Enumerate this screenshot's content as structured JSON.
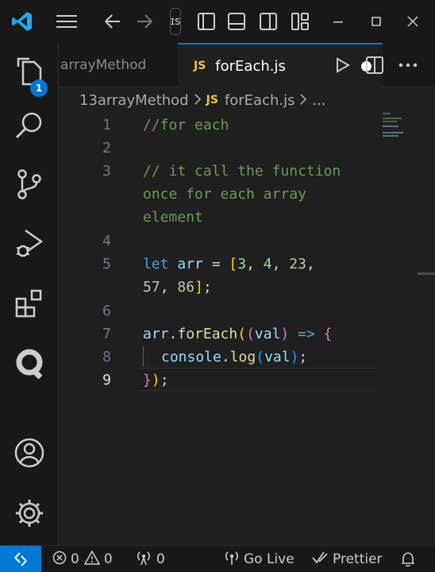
{
  "titlebar": {
    "search_fragment": "ɪs"
  },
  "activity": {
    "explorer_badge": "1"
  },
  "tabs": {
    "inactive_label": "arrayMethod",
    "active_label": "forEach.js",
    "active_lang": "JS"
  },
  "breadcrumb": {
    "folder": "13arrayMethod",
    "lang": "JS",
    "file": "forEach.js",
    "more": "..."
  },
  "editor": {
    "line_numbers": [
      "1",
      "2",
      "3",
      "",
      "",
      "4",
      "5",
      "",
      "6",
      "7",
      "8",
      "9"
    ],
    "lines": {
      "l1": "//for each",
      "l3a": "// it call the function",
      "l3b": "once for each array",
      "l3c": "element",
      "l5_let": "let",
      "l5_arr": "arr",
      "l5_eq": " = ",
      "l5_open": "[",
      "l5_n1": "3",
      "l5_c1": ", ",
      "l5_n2": "4",
      "l5_c2": ", ",
      "l5_n3": "23",
      "l5_c3": ",",
      "l5_n4": "57",
      "l5_c4": ", ",
      "l5_n5": "86",
      "l5_close": "]",
      "l5_semi": ";",
      "l7_arr": "arr",
      "l7_dot": ".",
      "l7_fn": "forEach",
      "l7_p1": "(",
      "l7_p2": "(",
      "l7_val": "val",
      "l7_p3": ")",
      "l7_arrow": " => ",
      "l7_brace": "{",
      "l8_console": "console",
      "l8_dot": ".",
      "l8_log": "log",
      "l8_p1": "(",
      "l8_val": "val",
      "l8_p2": ")",
      "l8_semi": ";",
      "l9_brace": "}",
      "l9_paren": ")",
      "l9_semi": ";"
    }
  },
  "statusbar": {
    "errors": "0",
    "warnings": "0",
    "ports": "0",
    "go_live": "Go Live",
    "prettier": "Prettier"
  },
  "colors": {
    "accent": "#0078d4",
    "background": "#1f1f1f",
    "sidebar": "#181818",
    "comment": "#6a9955",
    "keyword": "#569cd6",
    "variable": "#9cdcfe",
    "number": "#b5cea8",
    "function": "#dcdcaa",
    "js_badge": "#e8c547"
  },
  "icons": [
    "vscode-logo-icon",
    "menu-icon",
    "arrow-left-icon",
    "arrow-right-icon",
    "toggle-primary-sidebar-icon",
    "toggle-panel-icon",
    "toggle-secondary-sidebar-icon",
    "customize-layout-icon",
    "minimize-icon",
    "maximize-icon",
    "close-icon",
    "files-icon",
    "search-icon",
    "source-control-icon",
    "run-debug-icon",
    "extensions-icon",
    "r-extension-icon",
    "account-icon",
    "settings-gear-icon",
    "run-icon",
    "split-editor-icon",
    "more-actions-icon",
    "remote-icon",
    "error-icon",
    "warning-icon",
    "broadcast-icon",
    "go-live-icon",
    "prettier-check-icon",
    "bell-icon"
  ]
}
